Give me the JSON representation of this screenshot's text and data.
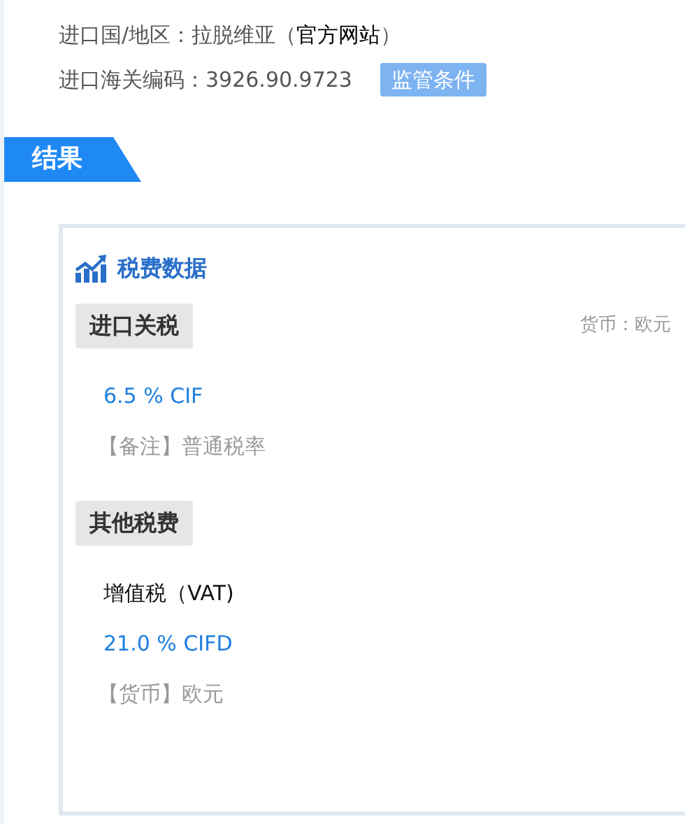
{
  "info": [
    {
      "text": "进口国/地区：拉脱维亚（",
      "link": "官方网站",
      "after": "）"
    },
    {
      "text": "进口海关编码：3926.90.9723",
      "button": "监管条件"
    }
  ],
  "result_tab": "结果",
  "card": {
    "title": "税费数据",
    "sections": [
      {
        "title": "进口关税",
        "currency": "货币：欧元",
        "items": [
          {
            "kind": "rate",
            "text": "6.5 % CIF"
          },
          {
            "kind": "note",
            "text": "【备注】普通税率"
          }
        ]
      },
      {
        "title": "其他税费",
        "items": [
          {
            "kind": "name",
            "text": "增值税（VAT)"
          },
          {
            "kind": "rate",
            "text": "21.0 % CIFD"
          },
          {
            "kind": "note",
            "text": "【货币】欧元"
          }
        ]
      }
    ]
  }
}
